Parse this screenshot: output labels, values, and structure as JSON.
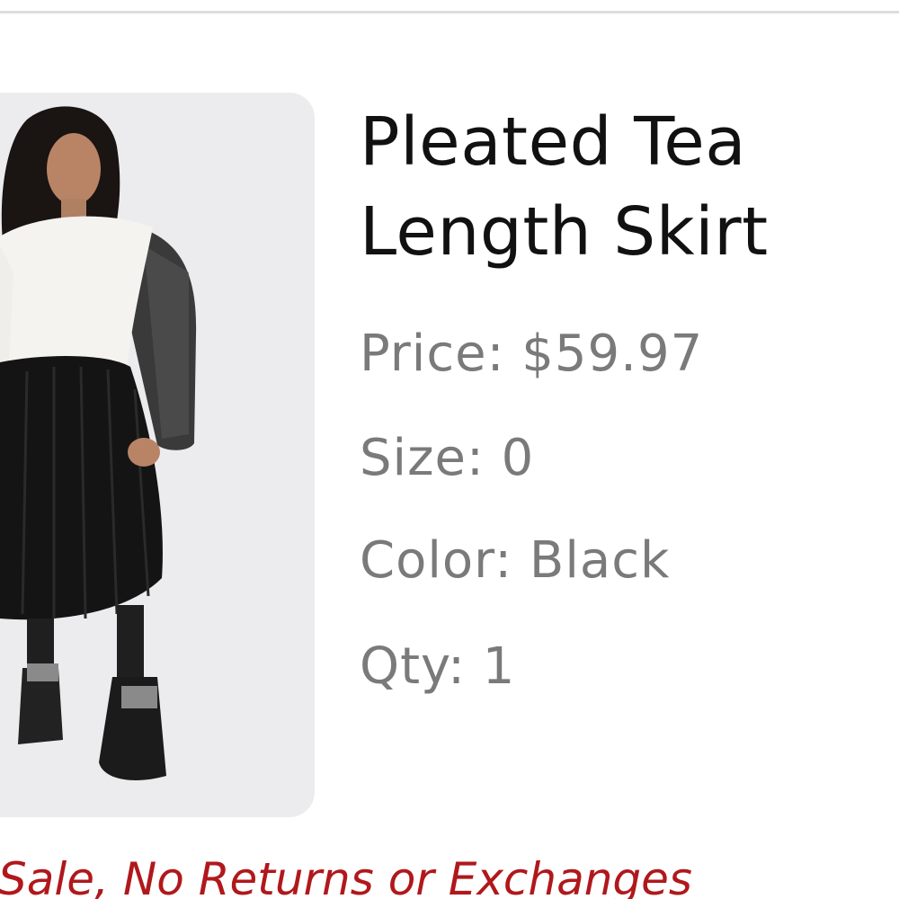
{
  "product": {
    "title_line1": "Pleated Tea",
    "title_line2": "Length Skirt",
    "price_label": "Price:",
    "price_value": "$59.97",
    "size_label": "Size:",
    "size_value": "0",
    "color_label": "Color:",
    "color_value": "Black",
    "qty_label": "Qty:",
    "qty_value": "1"
  },
  "notice": {
    "text": "Sale, No Returns or Exchanges",
    "color": "#b0181c"
  },
  "colors": {
    "title": "#111111",
    "detail": "#7a7a7a",
    "image_bg": "#ececef",
    "divider": "#dddddd"
  }
}
